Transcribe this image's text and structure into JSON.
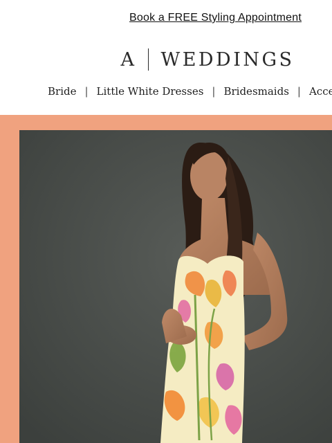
{
  "promo": {
    "label": "Book a FREE Styling Appointment"
  },
  "brand": {
    "letter": "A",
    "name": "WEDDINGS"
  },
  "nav": {
    "items": [
      {
        "label": "Bride"
      },
      {
        "label": "Little White Dresses"
      },
      {
        "label": "Bridesmaids"
      },
      {
        "label": "Acces"
      }
    ],
    "separator": "|"
  },
  "hero": {
    "icon": "model-in-floral-dress-photo",
    "colors": {
      "border": "#f0a27f",
      "backdrop": "#4a4e4b",
      "dress": "#f5ecc3"
    }
  }
}
